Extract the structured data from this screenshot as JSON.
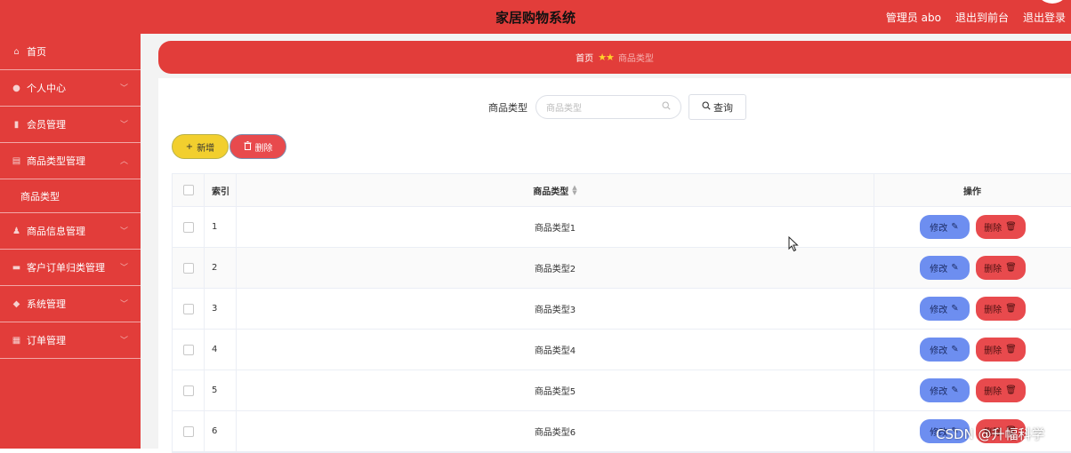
{
  "header": {
    "title": "家居购物系统",
    "admin_label": "管理员 abo",
    "back_frontend": "退出到前台",
    "logout": "退出登录"
  },
  "sidebar": {
    "items": [
      {
        "label": "首页",
        "icon": "home-icon"
      },
      {
        "label": "个人中心",
        "icon": "user-icon"
      },
      {
        "label": "会员管理",
        "icon": "members-icon"
      },
      {
        "label": "商品类型管理",
        "icon": "clipboard-icon"
      },
      {
        "label": "商品信息管理",
        "icon": "person-icon"
      },
      {
        "label": "客户订单归类管理",
        "icon": "chat-icon"
      },
      {
        "label": "系统管理",
        "icon": "location-icon"
      },
      {
        "label": "订单管理",
        "icon": "grid-icon"
      }
    ],
    "subitem": "商品类型"
  },
  "breadcrumb": {
    "home": "首页",
    "current": "商品类型"
  },
  "search": {
    "label": "商品类型",
    "placeholder": "商品类型",
    "button": "查询"
  },
  "actions": {
    "add": "新增",
    "delete": "删除"
  },
  "table": {
    "headers": {
      "index": "索引",
      "type": "商品类型",
      "op": "操作"
    },
    "rows": [
      {
        "index": "1",
        "type": "商品类型1"
      },
      {
        "index": "2",
        "type": "商品类型2"
      },
      {
        "index": "3",
        "type": "商品类型3"
      },
      {
        "index": "4",
        "type": "商品类型4"
      },
      {
        "index": "5",
        "type": "商品类型5"
      },
      {
        "index": "6",
        "type": "商品类型6"
      }
    ],
    "edit_label": "修改",
    "delete_label": "删除"
  },
  "watermark": "CSDN @升幅科学",
  "colors": {
    "primary": "#e23d3a",
    "add_button": "#f2cf2e",
    "edit_button": "#6d8ef0",
    "delete_button": "#e84a4d"
  }
}
